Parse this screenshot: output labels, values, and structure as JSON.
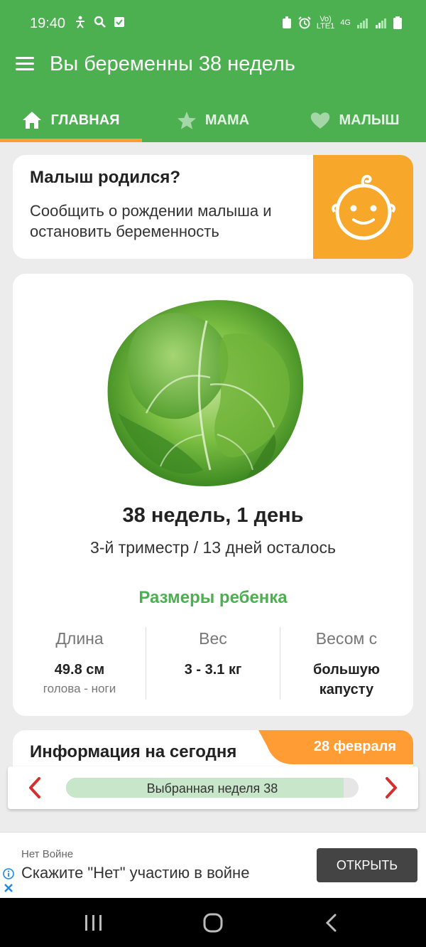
{
  "status": {
    "time": "19:40",
    "signal_label_1": "Vo)",
    "signal_label_2": "LTE1",
    "signal_label_3": "4G"
  },
  "appbar": {
    "title": "Вы беременны 38 недель"
  },
  "tabs": [
    {
      "label": "ГЛАВНАЯ",
      "icon": "home-icon"
    },
    {
      "label": "МАМА",
      "icon": "star-icon"
    },
    {
      "label": "МАЛЫШ",
      "icon": "heart-icon"
    }
  ],
  "born_card": {
    "question": "Малыш родился?",
    "description": "Сообщить о рождении малыша и остановить беременность",
    "icon": "baby-face-icon",
    "accent_color": "#f7a72a"
  },
  "main": {
    "week_text": "38 недель, 1 день",
    "trimester_text": "3-й триместр / 13 дней осталось",
    "sizes_title": "Размеры ребенка",
    "stats": [
      {
        "label": "Длина",
        "value": "49.8 см",
        "sub": "голова - ноги"
      },
      {
        "label": "Вес",
        "value": "3 - 3.1 кг",
        "sub": ""
      },
      {
        "label": "Весом с",
        "value": "большую капусту",
        "sub": ""
      }
    ]
  },
  "info": {
    "title": "Информация на сегодня",
    "date": "28 февраля"
  },
  "week_selector": {
    "label": "Выбранная неделя 38",
    "progress_fraction": 0.95
  },
  "ad": {
    "sponsor": "Нет Войне",
    "headline": "Скажите \"Нет\" участию в войне",
    "button": "ОТКРЫТЬ"
  },
  "colors": {
    "primary": "#4caf50",
    "accent": "#ff9c33",
    "orange": "#f7a72a"
  }
}
